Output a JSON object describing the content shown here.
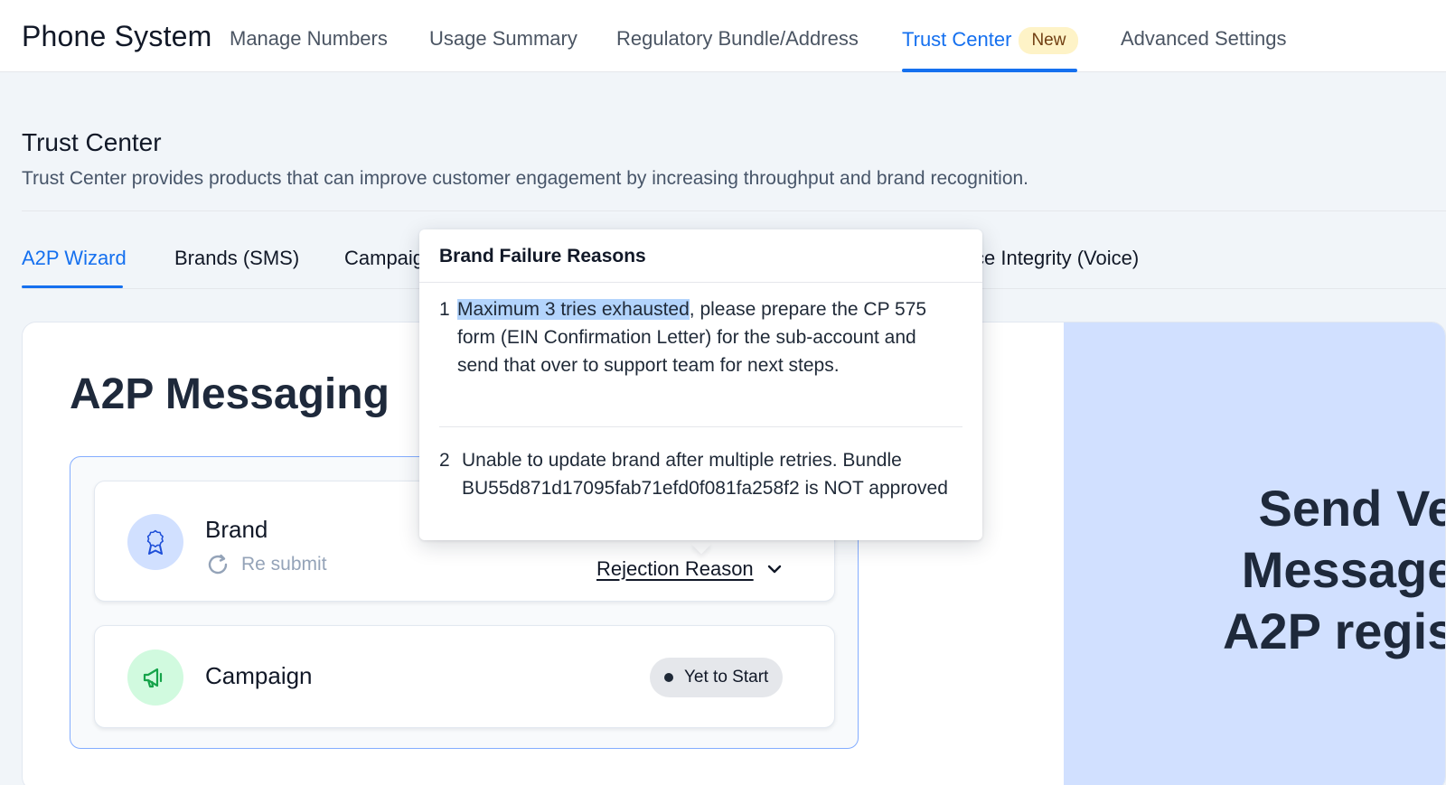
{
  "app": {
    "title": "Phone System"
  },
  "nav": {
    "tabs": [
      {
        "label": "Manage Numbers"
      },
      {
        "label": "Usage Summary"
      },
      {
        "label": "Regulatory Bundle/Address"
      },
      {
        "label": "Trust Center",
        "badge": "New",
        "active": true
      },
      {
        "label": "Advanced Settings"
      }
    ]
  },
  "header": {
    "title": "Trust Center",
    "subtitle": "Trust Center provides products that can improve customer engagement by increasing throughput and brand recognition."
  },
  "subtabs": [
    {
      "label": "A2P Wizard",
      "active": true
    },
    {
      "label": "Brands (SMS)"
    },
    {
      "label": "Campaig"
    },
    {
      "label": "ce Integrity (Voice)"
    }
  ],
  "main": {
    "title": "A2P Messaging",
    "steps": {
      "brand": {
        "name": "Brand",
        "resubmit_label": "Re submit",
        "rejection_label": "Rejection Reason"
      },
      "campaign": {
        "name": "Campaign",
        "status": "Yet to Start"
      }
    },
    "promo": {
      "line1": "Send Ve",
      "line2": "Message",
      "line3": "A2P regis"
    }
  },
  "popover": {
    "title": "Brand Failure Reasons",
    "reasons": [
      {
        "num": "1",
        "highlighted": "Maximum 3 tries exhausted",
        "rest": ", please prepare the CP 575 form (EIN Confirmation Letter) for the sub-account and send that over to support team for next steps."
      },
      {
        "num": "2",
        "text": "Unable to update brand after multiple retries. Bundle BU55d871d17095fab71efd0f081fa258f2 is NOT approved"
      }
    ]
  },
  "colors": {
    "accent": "#1570ef",
    "badge_bg": "#fef3c7",
    "promo_bg": "#d1e0ff",
    "highlight": "#b3d4fc"
  }
}
